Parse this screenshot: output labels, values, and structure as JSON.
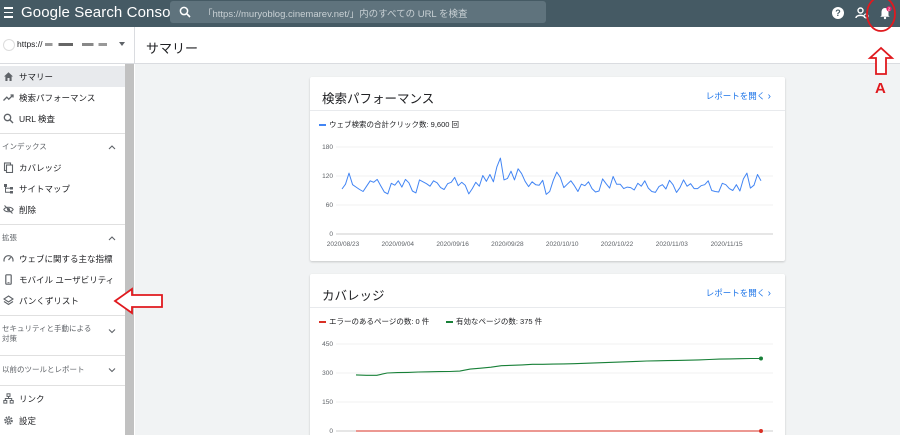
{
  "app": {
    "title_brand": "Google",
    "title_product": " Search Console",
    "search_placeholder": "「https://muryoblog.cinemarev.net/」内のすべての URL を検査"
  },
  "icons": {
    "menu": "hamburger-menu-icon",
    "search": "search-icon",
    "help": "help-icon",
    "account": "account-settings-icon",
    "notifications": "bell-icon"
  },
  "notifications": {
    "count": "2"
  },
  "property": {
    "url_prefix": "https://"
  },
  "page": {
    "title": "サマリー"
  },
  "sidebar": {
    "items": [
      {
        "label": "サマリー",
        "icon": "home-icon",
        "active": true
      },
      {
        "label": "検索パフォーマンス",
        "icon": "trending-up-icon"
      },
      {
        "label": "URL 検査",
        "icon": "search-icon"
      }
    ],
    "sections": [
      {
        "label": "インデックス",
        "items": [
          {
            "label": "カバレッジ",
            "icon": "coverage-icon"
          },
          {
            "label": "サイトマップ",
            "icon": "sitemap-icon"
          },
          {
            "label": "削除",
            "icon": "removal-icon"
          }
        ]
      },
      {
        "label": "拡張",
        "items": [
          {
            "label": "ウェブに関する主な指標",
            "icon": "speed-icon"
          },
          {
            "label": "モバイル ユーザビリティ",
            "icon": "mobile-icon"
          },
          {
            "label": "パンくずリスト",
            "icon": "layers-icon"
          }
        ]
      },
      {
        "label": "セキュリティと手動による対策"
      },
      {
        "label": "以前のツールとレポート"
      }
    ],
    "bottom_items": [
      {
        "label": "リンク",
        "icon": "links-icon"
      },
      {
        "label": "設定",
        "icon": "settings-icon"
      }
    ]
  },
  "cards": {
    "performance": {
      "title": "検索パフォーマンス",
      "link": "レポートを開く",
      "legend": "ウェブ検索の合計クリック数: 9,600 回"
    },
    "coverage": {
      "title": "カバレッジ",
      "link": "レポートを開く",
      "legend_error": "エラーのあるページの数: 0 件",
      "legend_valid": "有効なページの数: 375 件"
    }
  },
  "colors": {
    "topbar": "#455a64",
    "clicks_line": "#4285f4",
    "error_line": "#d93025",
    "valid_line": "#188038",
    "link": "#1a73e8",
    "annotation": "#e0191e"
  },
  "annotation": {
    "label": "A"
  },
  "chart_data": [
    {
      "type": "line",
      "x_labels": [
        "2020/08/23",
        "2020/09/04",
        "2020/09/16",
        "2020/09/28",
        "2020/10/10",
        "2020/10/22",
        "2020/11/03",
        "2020/11/15"
      ],
      "y_ticks": [
        "180",
        "120",
        "60",
        "0"
      ],
      "ylim": [
        0,
        180
      ],
      "series": [
        {
          "name": "ウェブ検索の合計クリック数",
          "color": "#4285f4",
          "values": [
            93,
            103,
            126,
            102,
            97,
            92,
            88,
            99,
            110,
            107,
            113,
            100,
            87,
            83,
            105,
            101,
            110,
            97,
            113,
            106,
            89,
            85,
            112,
            108,
            104,
            99,
            110,
            106,
            96,
            92,
            104,
            107,
            117,
            100,
            107,
            101,
            83,
            94,
            107,
            99,
            121,
            109,
            123,
            108,
            139,
            157,
            112,
            115,
            130,
            112,
            135,
            125,
            109,
            98,
            108,
            102,
            101,
            111,
            82,
            88,
            111,
            128,
            117,
            96,
            103,
            110,
            100,
            88,
            103,
            100,
            108,
            94,
            87,
            89,
            114,
            104,
            95,
            119,
            103,
            103,
            94,
            97,
            96,
            91,
            105,
            99,
            110,
            95,
            88,
            86,
            98,
            102,
            93,
            111,
            102,
            86,
            96,
            112,
            99,
            104,
            94,
            94,
            100,
            102,
            110,
            90,
            88,
            87,
            105,
            102,
            94,
            90,
            102,
            89,
            114,
            126,
            95,
            101,
            123,
            110
          ]
        }
      ]
    },
    {
      "type": "line",
      "y_ticks": [
        "450",
        "300",
        "150",
        "0"
      ],
      "ylim": [
        0,
        450
      ],
      "series": [
        {
          "name": "エラーのあるページの数",
          "color": "#d93025",
          "values": [
            0,
            0,
            0,
            0,
            0,
            0,
            0,
            0,
            0,
            0,
            0,
            0,
            0,
            0,
            0,
            0,
            0,
            0,
            0,
            0,
            0,
            0,
            0,
            0,
            0,
            0,
            0,
            0,
            0,
            0,
            0,
            0,
            0,
            0,
            0,
            0,
            0,
            0,
            0,
            0
          ]
        },
        {
          "name": "有効なページの数",
          "color": "#188038",
          "values": [
            290,
            288,
            288,
            300,
            302,
            303,
            305,
            306,
            307,
            308,
            310,
            320,
            325,
            330,
            338,
            340,
            342,
            345,
            345,
            346,
            347,
            348,
            350,
            352,
            354,
            356,
            358,
            360,
            362,
            363,
            364,
            365,
            366,
            368,
            370,
            372,
            373,
            374,
            375,
            375
          ]
        }
      ]
    }
  ]
}
